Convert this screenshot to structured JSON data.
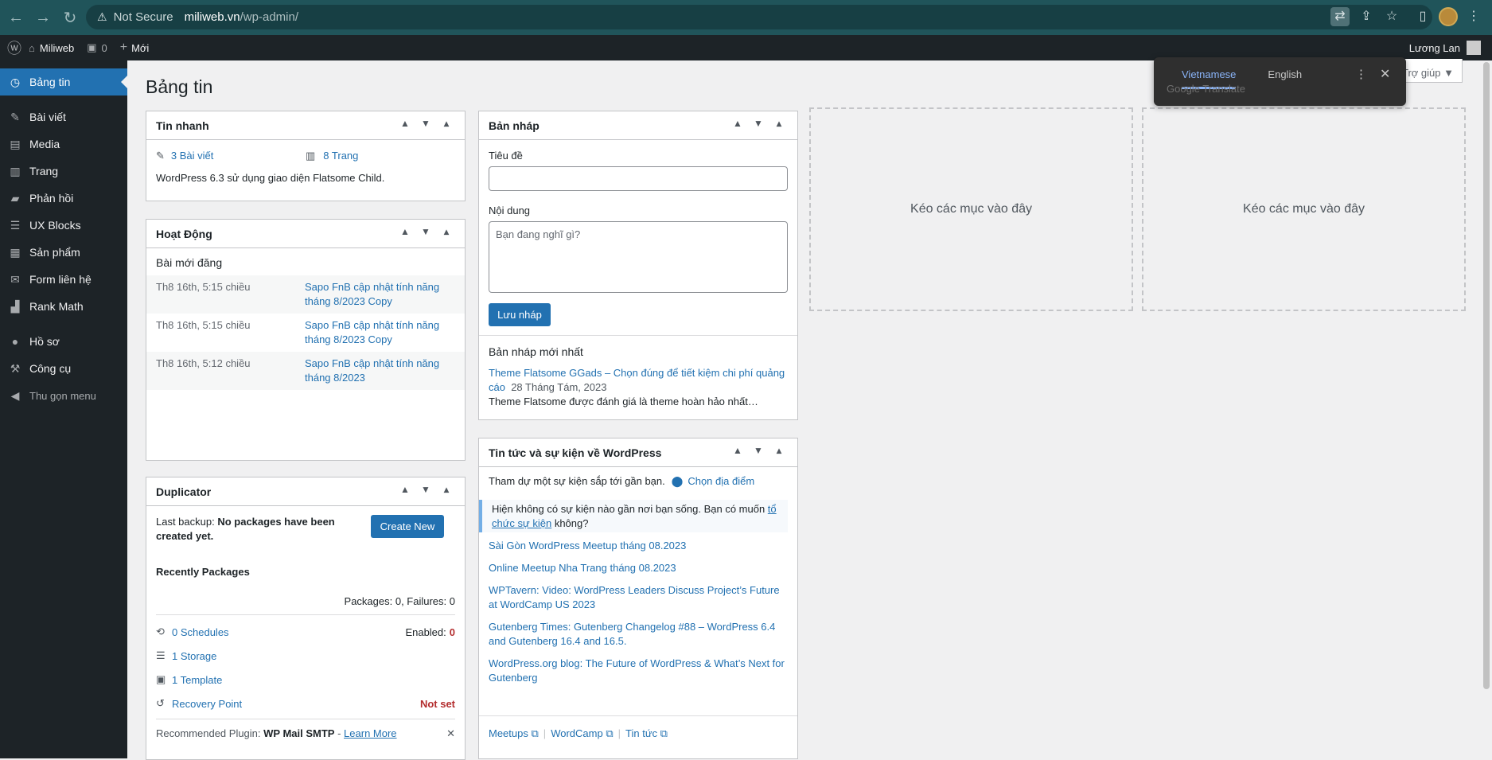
{
  "browser": {
    "not_secure": "Not Secure",
    "url_host": "miliweb.vn",
    "url_path": "/wp-admin/"
  },
  "adminbar": {
    "site": "Miliweb",
    "comments": "0",
    "new": "Mới",
    "user": "Lương Lan"
  },
  "translate": {
    "tab1": "Vietnamese",
    "tab2": "English",
    "brand": "Google Translate"
  },
  "sidebar": {
    "items": [
      {
        "label": "Bảng tin",
        "icon": "dashboard-icon"
      },
      {
        "label": "Bài viết",
        "icon": "pin-icon"
      },
      {
        "label": "Media",
        "icon": "media-icon"
      },
      {
        "label": "Trang",
        "icon": "page-icon"
      },
      {
        "label": "Phản hồi",
        "icon": "comment-icon"
      },
      {
        "label": "UX Blocks",
        "icon": "blocks-icon"
      },
      {
        "label": "Sản phẩm",
        "icon": "product-icon"
      },
      {
        "label": "Form liên hệ",
        "icon": "mail-icon"
      },
      {
        "label": "Rank Math",
        "icon": "chart-icon"
      },
      {
        "label": "Hồ sơ",
        "icon": "user-icon"
      },
      {
        "label": "Công cụ",
        "icon": "wrench-icon"
      },
      {
        "label": "Thu gọn menu",
        "icon": "collapse-icon"
      }
    ]
  },
  "page": {
    "title": "Bảng tin",
    "help": "Trợ giúp ▼"
  },
  "quick": {
    "title": "Tin nhanh",
    "posts": "3 Bài viết",
    "pages": "8 Trang",
    "theme_note": "WordPress 6.3 sử dụng giao diện Flatsome Child."
  },
  "activity": {
    "title": "Hoạt Động",
    "sub": "Bài mới đăng",
    "rows": [
      {
        "date": "Th8 16th, 5:15 chiều",
        "title": "Sapo FnB cập nhật tính năng tháng 8/2023 Copy"
      },
      {
        "date": "Th8 16th, 5:15 chiều",
        "title": "Sapo FnB cập nhật tính năng tháng 8/2023 Copy"
      },
      {
        "date": "Th8 16th, 5:12 chiều",
        "title": "Sapo FnB cập nhật tính năng tháng 8/2023"
      }
    ]
  },
  "duplicator": {
    "title": "Duplicator",
    "last_backup_label": "Last backup:",
    "last_backup_value": "No packages have been created yet.",
    "create": "Create New",
    "recent": "Recently Packages",
    "counts": "Packages: 0, Failures: 0",
    "schedules": "0 Schedules",
    "enabled_label": "Enabled:",
    "enabled_value": "0",
    "storage": "1 Storage",
    "template": "1 Template",
    "recovery": "Recovery Point",
    "not_set": "Not set",
    "rec_label": "Recommended Plugin:",
    "rec_plugin": "WP Mail SMTP",
    "rec_sep": " - ",
    "learn": "Learn More"
  },
  "draft": {
    "title": "Bản nháp",
    "title_label": "Tiêu đề",
    "content_label": "Nội dung",
    "content_placeholder": "Bạn đang nghĩ gì?",
    "save": "Lưu nháp",
    "latest": "Bản nháp mới nhất",
    "item_title": "Theme Flatsome GGads – Chọn đúng để tiết kiệm chi phí quảng cáo",
    "item_date": "28 Tháng Tám, 2023",
    "item_excerpt": "Theme Flatsome được đánh giá là theme hoàn hảo nhất…"
  },
  "news": {
    "title": "Tin tức và sự kiện về WordPress",
    "attend": "Tham dự một sự kiện sắp tới gần bạn.",
    "choose": "Chọn địa điểm",
    "notice_pre": "Hiện không có sự kiện nào gần nơi bạn sống. Bạn có muốn ",
    "notice_link": "tổ chức sự kiện",
    "notice_post": " không?",
    "links": [
      "Sài Gòn WordPress Meetup tháng 08.2023",
      "Online Meetup Nha Trang tháng 08.2023",
      "WPTavern: Video: WordPress Leaders Discuss Project’s Future at WordCamp US 2023",
      "Gutenberg Times: Gutenberg Changelog #88 – WordPress 6.4 and Gutenberg 16.4 and 16.5.",
      "WordPress.org blog: The Future of WordPress & What’s Next for Gutenberg"
    ],
    "foot": [
      "Meetups",
      "WordCamp",
      "Tin tức"
    ]
  },
  "drop": {
    "label": "Kéo các mục vào đây"
  }
}
